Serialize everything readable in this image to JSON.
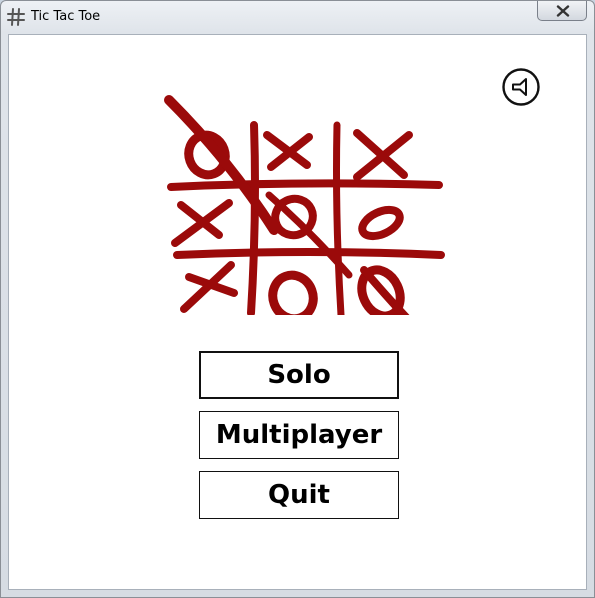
{
  "window": {
    "title": "Tic Tac Toe"
  },
  "titlebar": {
    "close_icon": "close-icon",
    "app_icon": "hash-grid-icon"
  },
  "header": {
    "sound_icon": "speaker-icon"
  },
  "logo": {
    "icon": "tic-tac-toe-logo",
    "color": "#9b0a0a"
  },
  "menu": {
    "solo_label": "Solo",
    "multiplayer_label": "Multiplayer",
    "quit_label": "Quit"
  }
}
